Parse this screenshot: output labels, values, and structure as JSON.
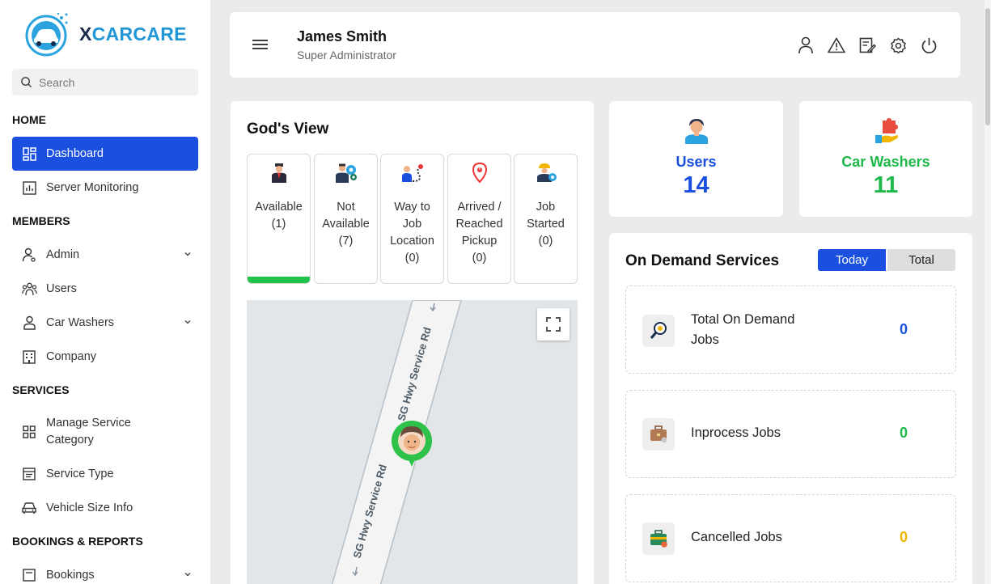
{
  "brand": {
    "logo_text_x": "X",
    "logo_text_rest": "CARCARE"
  },
  "sidebar": {
    "search_placeholder": "Search",
    "sections": {
      "home": "HOME",
      "members": "MEMBERS",
      "services": "SERVICES",
      "bookings": "BOOKINGS & REPORTS"
    },
    "items": {
      "dashboard": "Dashboard",
      "server_monitoring": "Server Monitoring",
      "admin": "Admin",
      "users": "Users",
      "car_washers": "Car Washers",
      "company": "Company",
      "manage_service_category_1": "Manage Service",
      "manage_service_category_2": "Category",
      "service_type": "Service Type",
      "vehicle_size_info": "Vehicle Size Info",
      "bookings": "Bookings"
    }
  },
  "header": {
    "name": "James Smith",
    "role": "Super Administrator"
  },
  "gods_view": {
    "title": "God's View",
    "tiles": [
      {
        "lines": [
          "Available",
          "(1)"
        ],
        "active": true
      },
      {
        "lines": [
          "Not",
          "Available",
          "(7)"
        ],
        "active": false
      },
      {
        "lines": [
          "Way to",
          "Job",
          "Location",
          "(0)"
        ],
        "active": false
      },
      {
        "lines": [
          "Arrived /",
          "Reached",
          "Pickup",
          "(0)"
        ],
        "active": false
      },
      {
        "lines": [
          "Job",
          "Started",
          "(0)"
        ],
        "active": false
      }
    ],
    "map": {
      "road_label": "SG Hwy Service Rd"
    }
  },
  "stats": {
    "users": {
      "label": "Users",
      "value": "14",
      "color": "#1a4fe0"
    },
    "car_washers": {
      "label": "Car Washers",
      "value": "11",
      "color": "#1fb84a"
    }
  },
  "on_demand": {
    "title": "On Demand Services",
    "tab_today": "Today",
    "tab_total": "Total",
    "jobs": [
      {
        "label_1": "Total On Demand",
        "label_2": "Jobs",
        "value": "0",
        "color": "#1a4fe0"
      },
      {
        "label_1": "Inprocess Jobs",
        "label_2": "",
        "value": "0",
        "color": "#1fb84a"
      },
      {
        "label_1": "Cancelled Jobs",
        "label_2": "",
        "value": "0",
        "color": "#f1b400"
      }
    ]
  }
}
